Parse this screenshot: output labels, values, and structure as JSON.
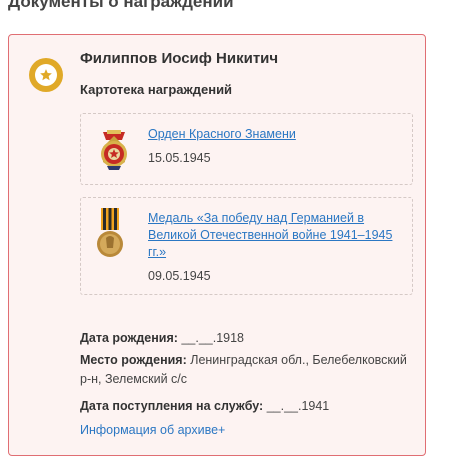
{
  "section": {
    "title": "Документы о награждении"
  },
  "card": {
    "badge_icon": "star-medal-icon",
    "person_name": "Филиппов Иосиф Никитич",
    "record_type": "Картотека награждений",
    "awards": [
      {
        "icon": "order-red-banner-icon",
        "name": "Орден Красного Знамени",
        "date": "15.05.1945"
      },
      {
        "icon": "victory-medal-icon",
        "name": "Медаль «За победу над Германией в Великой Отечественной войне 1941–1945 гг.»",
        "date": "09.05.1945"
      }
    ],
    "birth_date": {
      "label": "Дата рождения:",
      "value": "__.__.1918"
    },
    "birth_place": {
      "label": "Место рождения:",
      "value": "Ленинградская обл., Белебелковский р-н, Зелемский с/с"
    },
    "service_date": {
      "label": "Дата поступления на службу:",
      "value": "__.__.1941"
    },
    "archive_link": "Информация об архиве+"
  },
  "colors": {
    "card_border": "#e06e73",
    "card_background": "#fdf3f2",
    "badge": "#e0a928",
    "link": "#2b77c3"
  }
}
